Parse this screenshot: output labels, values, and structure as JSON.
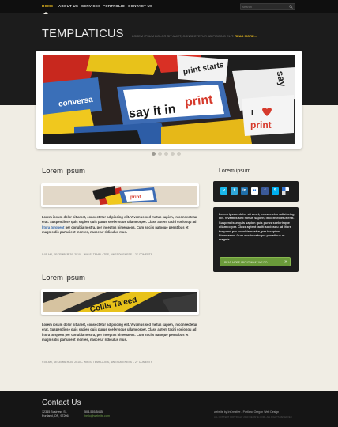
{
  "nav": {
    "items": [
      {
        "label": "HOME"
      },
      {
        "label": "ABOUT US"
      },
      {
        "label": "SERVICES"
      },
      {
        "label": "PORTFOLIO"
      },
      {
        "label": "CONTACT US"
      }
    ],
    "active": "HOME",
    "search_placeholder": "search"
  },
  "header": {
    "logo": "TEMPLATICUS",
    "tagline": "LOREM IPSUM DOLOR SIT AMET, CONSECTETUR ADIPISCING ELIT.",
    "tagline_link": "READ MORE..."
  },
  "slider": {
    "words": {
      "say_it_in": "say it in",
      "print": "print",
      "i_love": "I",
      "print2": "print",
      "print_starts": "print starts",
      "conversation": "conversa",
      "say": "say"
    },
    "dots": 5,
    "active_dot": 0
  },
  "posts": [
    {
      "title": "Lorem ipsum",
      "text_before_link": "Lorem ipsum dolor sit amet, consectetur adipiscing elit. Vivamus sed metus sapien, in consectetur erat. Suspendisse quis sapien quis purus scelerisque ullamcorper. Class aptent taciti sociosqu ad",
      "link": "litora torquent",
      "text_after_link": "per conubia nostra, per inceptos himenaeos. Cum sociis natoque penatibus et magnis dis parturient montes, nascetur ridiculus mus.",
      "meta": "9:05 AM, DECEMBER 20, 2010 – WIKIS, TEMPLATES, AWESOMENESS – 27 COMENTS"
    },
    {
      "title": "Lorem ipsum",
      "text_before_link": "Lorem ipsum dolor sit amet, consectetur adipiscing elit. Vivamus sed metus sapien, in consectetur erat. Suspendisse quis sapien quis purus scelerisque ullamcorper. Class aptent taciti sociosqu ad litora torquent per conubia nostra, per inceptos himenaeos. Cum sociis natoque penatibus et magnis dis parturient montes, nascetur ridiculus mus.",
      "meta": "9:05 AM, DECEMBER 20, 2010 – WIKIS, TEMPLATES, AWESOMENESS – 27 COMENTS"
    }
  ],
  "sidebar": {
    "title": "Lorem ipsum",
    "social": [
      {
        "icon": "vimeo-icon",
        "glyph": "v",
        "color": "#1ab7ea"
      },
      {
        "icon": "twitter-icon",
        "glyph": "t",
        "color": "#2fa6d8"
      },
      {
        "icon": "linkedin-icon",
        "glyph": "in",
        "color": "#1f6ea8"
      },
      {
        "icon": "flickr-icon",
        "glyph": "••",
        "color": "#ffffff"
      },
      {
        "icon": "facebook-icon",
        "glyph": "f",
        "color": "#3b5998"
      },
      {
        "icon": "skype-icon",
        "glyph": "S",
        "color": "#00aff0"
      },
      {
        "icon": "delicious-icon",
        "glyph": "",
        "color": "#3274d1"
      }
    ],
    "about_text": "Lorem ipsum dolor sit amet, consectetur adipiscing elit. Vivamus sed metus sapien, in consectetur erat. Suspendisse quis sapien quis purus scelerisque ullamcorper. Class aptent taciti sociosqu ad litora torquent per conubia nostra, per inceptos himenaeos. Cum sociis natoque penatibus et magnis.",
    "about_button": "READ MORE ABOUT WHAT WE DO",
    "about_button_arrow": "»"
  },
  "footer": {
    "title": "Contact Us",
    "address_line1": "12345 Business St.",
    "address_line2": "Portland, OR, 97206",
    "phone": "503-555-5445",
    "email": "hello@website.com",
    "credit": "website by InCreative - Portland Oregon Web Design",
    "copyright": "ALL CONTENT COPYRIGHT 2010 WEBSITE.COM - ALL RIGHTS RESERVED"
  },
  "colors": {
    "accent": "#f0c020",
    "button_green": "#6a9a3a",
    "link_blue": "#3366aa"
  }
}
